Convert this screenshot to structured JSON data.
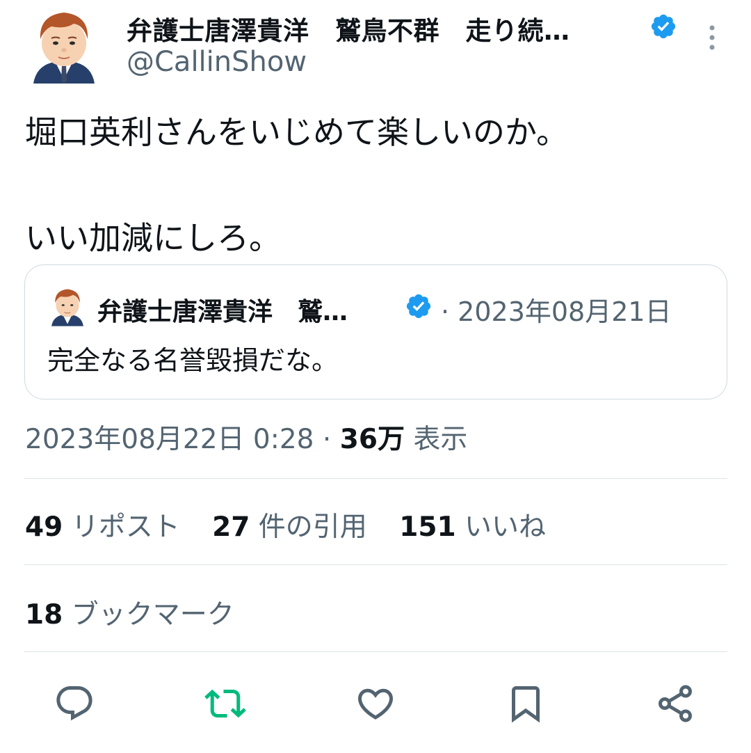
{
  "tweet": {
    "author_name": "弁護士唐澤貴洋　鷲鳥不群　走り続…",
    "author_handle": "@CallinShow",
    "text": "堀口英利さんをいじめて楽しいのか。\n\nいい加減にしろ。",
    "timestamp": "2023年08月22日 0:28",
    "meta_separator": " · ",
    "views_count": "36万",
    "views_label": "表示"
  },
  "quote": {
    "author_name": "弁護士唐澤貴洋　鷲…",
    "date": "· 2023年08月21日",
    "text": "完全なる名誉毀損だな。"
  },
  "stats": {
    "reposts": {
      "count": "49",
      "label": "リポスト"
    },
    "quotes": {
      "count": "27",
      "label": "件の引用"
    },
    "likes": {
      "count": "151",
      "label": "いいね"
    },
    "bookmarks": {
      "count": "18",
      "label": "ブックマーク"
    }
  },
  "actions": [
    {
      "icon": "reply-icon"
    },
    {
      "icon": "retweet-icon",
      "color": "#00ba7c"
    },
    {
      "icon": "like-icon"
    },
    {
      "icon": "bookmark-icon"
    },
    {
      "icon": "share-icon"
    }
  ],
  "colors": {
    "text": "#0f1419",
    "secondary": "#536471",
    "verified": "#1d9bf0",
    "retweet_active": "#00ba7c",
    "border": "#cfd9de"
  }
}
